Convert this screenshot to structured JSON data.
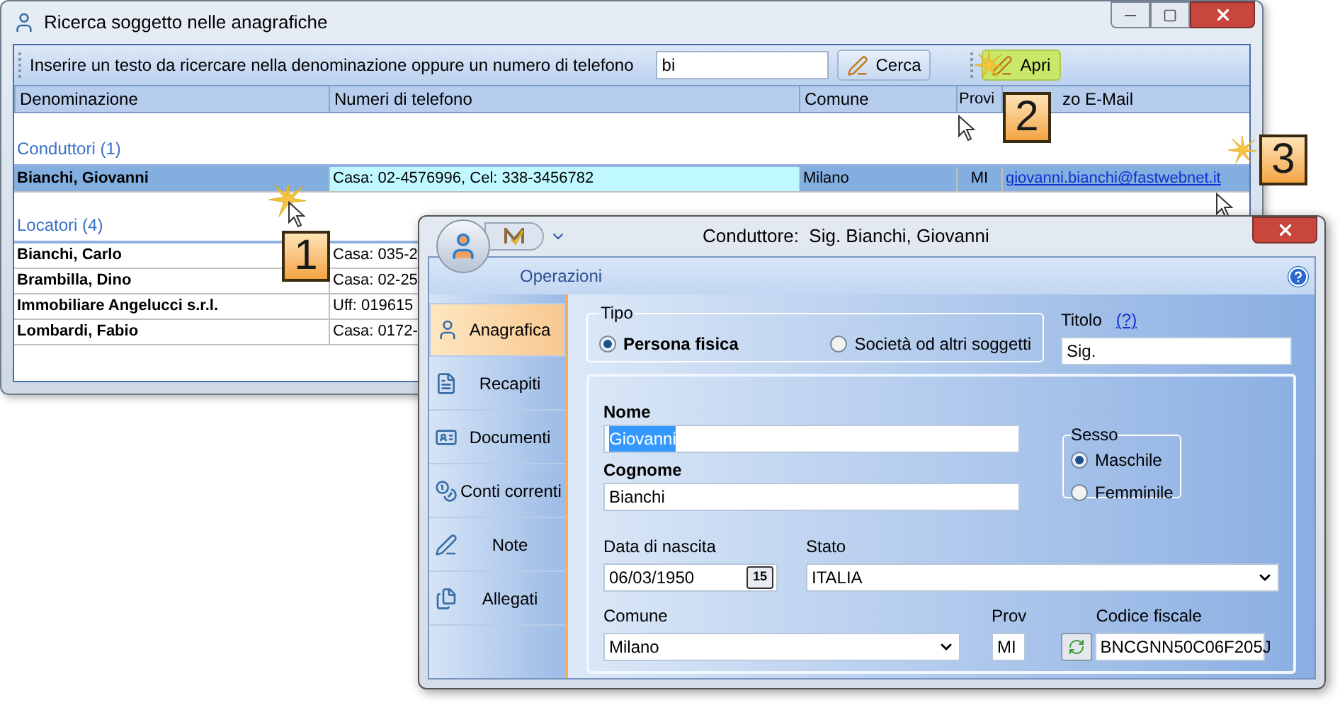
{
  "search_window": {
    "title": "Ricerca soggetto nelle anagrafiche",
    "search": {
      "label": "Inserire un testo da ricercare nella denominazione oppure un numero di telefono",
      "value": "bi"
    },
    "buttons": [
      {
        "label": "Cerca",
        "hovered": false
      },
      {
        "label": "Apri",
        "hovered": true
      }
    ],
    "table": {
      "columns": [
        "Denominazione",
        "Numeri di telefono",
        "Comune",
        "Provi",
        "zo E-Mail"
      ],
      "groups": [
        {
          "title": "Conduttori (1)",
          "rows": [
            {
              "selected": true,
              "cells": [
                "Bianchi, Giovanni",
                "Casa: 02-4576996, Cel: 338-3456782",
                "Milano",
                "MI",
                "giovanni.bianchi@fastwebnet.it"
              ]
            }
          ]
        },
        {
          "title": "Locatori (4)",
          "rows": [
            {
              "selected": false,
              "cells": [
                "Bianchi, Carlo",
                "Casa: 035-2"
              ]
            },
            {
              "selected": false,
              "cells": [
                "Brambilla, Dino",
                "Casa: 02-25"
              ]
            },
            {
              "selected": false,
              "cells": [
                "Immobiliare Angelucci s.r.l.",
                "Uff: 019615"
              ]
            },
            {
              "selected": false,
              "cells": [
                "Lombardi, Fabio",
                "Casa: 0172-"
              ]
            }
          ]
        }
      ]
    }
  },
  "detail_window": {
    "title": "Conduttore:  Sig. Bianchi, Giovanni",
    "ribbon_tab": "Operazioni",
    "nav": [
      {
        "label": "Anagrafica",
        "selected": true
      },
      {
        "label": "Recapiti",
        "selected": false
      },
      {
        "label": "Documenti",
        "selected": false
      },
      {
        "label": "Conti correnti",
        "selected": false
      },
      {
        "label": "Note",
        "selected": false
      },
      {
        "label": "Allegati",
        "selected": false
      }
    ],
    "form": {
      "tipo": {
        "label": "Tipo",
        "options": [
          {
            "label": "Persona fisica",
            "selected": true
          },
          {
            "label": "Società od altri soggetti",
            "selected": false
          }
        ]
      },
      "titolo": {
        "label": "Titolo",
        "help": "(?)",
        "value": "Sig."
      },
      "nome": {
        "label": "Nome",
        "value": "Giovanni"
      },
      "cognome": {
        "label": "Cognome",
        "value": "Bianchi"
      },
      "sesso": {
        "label": "Sesso",
        "options": [
          {
            "label": "Maschile",
            "selected": true
          },
          {
            "label": "Femminile",
            "selected": false
          }
        ]
      },
      "data_nascita": {
        "label": "Data di nascita",
        "value": "06/03/1950",
        "button": "15"
      },
      "stato": {
        "label": "Stato",
        "value": "ITALIA"
      },
      "comune": {
        "label": "Comune",
        "value": "Milano"
      },
      "prov": {
        "label": "Prov",
        "value": "MI"
      },
      "codice_fiscale": {
        "label": "Codice fiscale",
        "value": "BNCGNN50C06F205J"
      }
    }
  },
  "callouts": [
    "1",
    "2",
    "3"
  ]
}
